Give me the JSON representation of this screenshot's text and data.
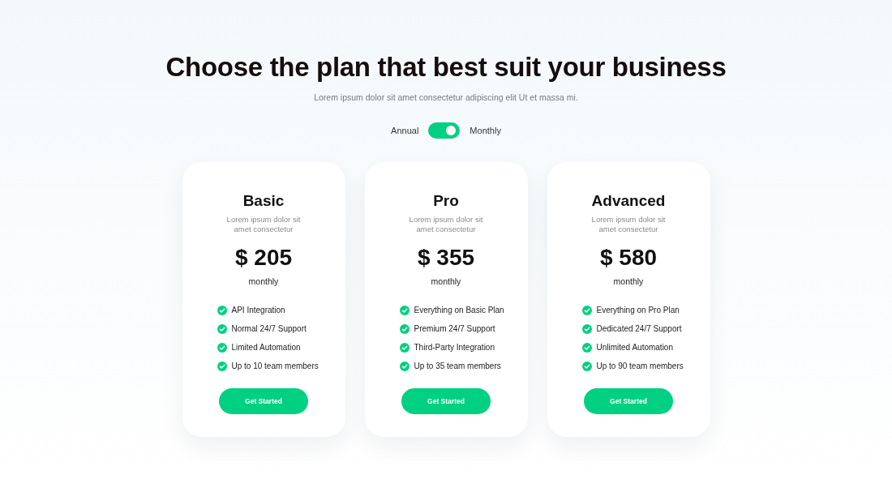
{
  "header": {
    "title": "Choose the plan that best suit your business",
    "subtitle": "Lorem ipsum dolor sit amet consectetur adipiscing elit Ut et massa mi."
  },
  "billing_toggle": {
    "left_label": "Annual",
    "right_label": "Monthly",
    "on": true
  },
  "plans": [
    {
      "name": "Basic",
      "description": "Lorem ipsum dolor sit amet consectetur",
      "price": "$ 205",
      "period": "monthly",
      "features": [
        "API Integration",
        "Normal 24/7 Support",
        "Limited Automation",
        "Up to 10 team members"
      ],
      "button": "Get Started"
    },
    {
      "name": "Pro",
      "description": "Lorem ipsum dolor sit amet consectetur",
      "price": "$ 355",
      "period": "monthly",
      "features": [
        "Everything on Basic Plan",
        "Premium 24/7 Support",
        "Third-Party Integration",
        "Up to 35 team members"
      ],
      "button": "Get Started"
    },
    {
      "name": "Advanced",
      "description": "Lorem ipsum dolor sit amet consectetur",
      "price": "$ 580",
      "period": "monthly",
      "features": [
        "Everything on Pro Plan",
        "Dedicated 24/7 Support",
        "Unlimited Automation",
        "Up to 90 team members"
      ],
      "button": "Get Started"
    }
  ]
}
